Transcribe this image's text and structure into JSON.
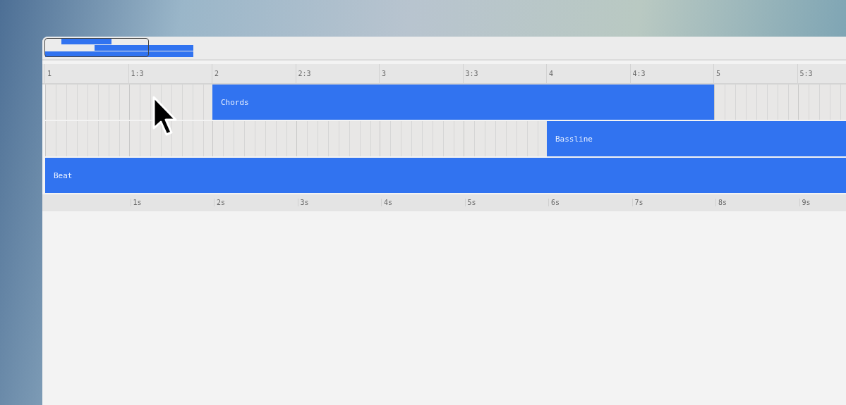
{
  "ruler": {
    "labels": [
      "1",
      "1:3",
      "2",
      "2:3",
      "3",
      "3:3",
      "4",
      "4:3",
      "5",
      "5:3"
    ]
  },
  "tracks": [
    {
      "clip": {
        "name": "Chords",
        "filled": [
          false,
          false,
          true,
          true,
          true,
          true,
          true,
          true,
          false,
          false
        ]
      }
    },
    {
      "clip": {
        "name": "Bassline",
        "filled": [
          false,
          false,
          false,
          false,
          false,
          false,
          true,
          true,
          true,
          true
        ]
      }
    },
    {
      "clip": {
        "name": "Beat",
        "filled": [
          true,
          true,
          true,
          true,
          true,
          true,
          true,
          true,
          true,
          true
        ]
      }
    }
  ],
  "time_axis": {
    "labels": [
      "1s",
      "2s",
      "3s",
      "4s",
      "5s",
      "6s",
      "7s",
      "8s",
      "9s"
    ]
  }
}
